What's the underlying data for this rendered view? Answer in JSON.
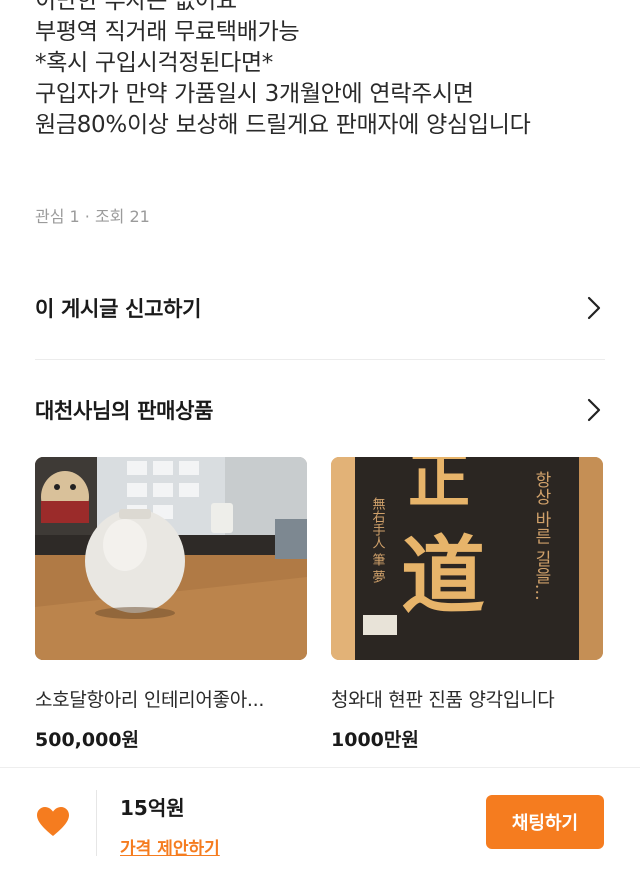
{
  "description": {
    "lines": [
      "이만한 투자는 없어요",
      "부평역 직거래 무료택배가능",
      "*혹시 구입시걱정된다면*",
      "구입자가 만약 가품일시 3개월안에 연락주시면",
      "원금80%이상 보상해 드릴게요 판매자에 양심입니다"
    ]
  },
  "meta": {
    "stats": "관심 1 · 조회 21"
  },
  "report": {
    "label": "이 게시글 신고하기",
    "icon": "chevron-right-icon"
  },
  "seller_products": {
    "title": "대천사님의 판매상품",
    "icon": "chevron-right-icon",
    "items": [
      {
        "name": "소호달항아리 인테리어좋아...",
        "price": "500,000원"
      },
      {
        "name": "청와대 현판 진품  양각입니다",
        "price": "1000만원"
      }
    ],
    "plaque_text": {
      "big_top": "正",
      "big_bottom": "道",
      "side": "항상 바른 길을…",
      "left": "無右手人 筆 夢"
    }
  },
  "bottom_bar": {
    "price": "15억원",
    "offer_link": "가격 제안하기",
    "chat_button": "채팅하기",
    "accent_color": "#f57c1f"
  }
}
